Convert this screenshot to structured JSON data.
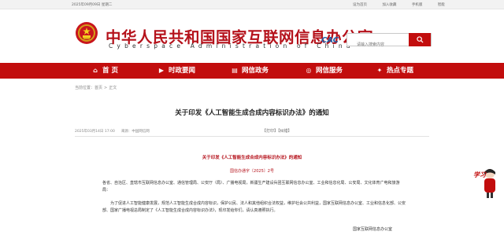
{
  "topbar": {
    "date": "2025年09月09日 星期二",
    "links": [
      "设为首页",
      "加入收藏",
      "手机版",
      "智能"
    ]
  },
  "header": {
    "title": "中华人民共和国国家互联网信息办公室",
    "subtitle": "Cyberspace Administration of China",
    "cac_logo": "CAC",
    "search_placeholder": "请输入搜索内容",
    "search_icon": "search-icon"
  },
  "nav": {
    "items": [
      {
        "label": "首 页",
        "icon": "home-icon"
      },
      {
        "label": "时政要闻",
        "icon": "flag-icon"
      },
      {
        "label": "网信政务",
        "icon": "doc-icon"
      },
      {
        "label": "网信服务",
        "icon": "service-icon"
      },
      {
        "label": "热点专题",
        "icon": "hot-icon"
      }
    ]
  },
  "breadcrumb": {
    "label": "当前位置：",
    "home": "首页",
    "sep": ">",
    "current": "正文"
  },
  "article": {
    "title": "关于印发《人工智能生成合成内容标识办法》的通知",
    "date": "2025年03月14日 17:00",
    "source_label": "来源：",
    "source": "中国网信网",
    "print": "【打印】",
    "close": "【纠错】",
    "doc_title": "关于印发《人工智能生成合成内容标识办法》的通知",
    "doc_no": "国信办通字〔2025〕2号",
    "para1": "各省、自治区、直辖市互联网信息办公室、通信管理局、公安厅（局）、广播电视局，新疆生产建设兵团互联网信息办公室、工业和信息化局、公安局、文化体育广电和旅游局：",
    "para2": "为了促进人工智能健康发展，规范人工智能生成合成内容标识，保护公民、法人和其他组织合法权益，维护社会公共利益，国家互联网信息办公室、工业和信息化部、公安部、国家广播电视总局制定了《人工智能生成合成内容标识办法》，现印发给你们，请认真遵照执行。",
    "signature": "国家互联网信息办公室"
  },
  "float_badge": {
    "label": "学习"
  }
}
